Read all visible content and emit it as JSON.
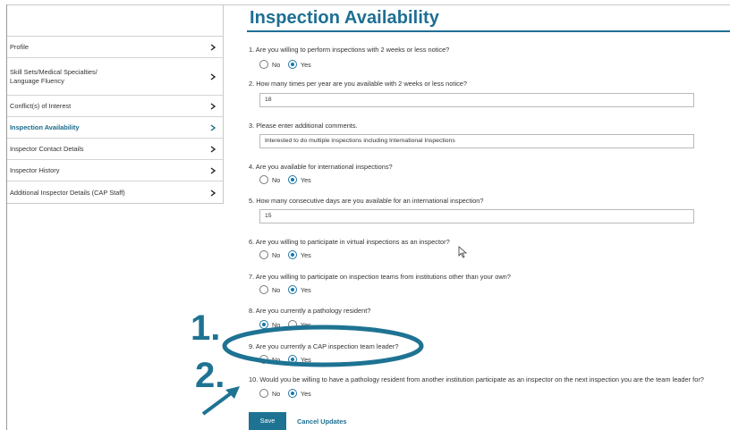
{
  "sidebar": {
    "items": [
      {
        "label": "Profile",
        "active": false
      },
      {
        "label": "Skill Sets/Medical Specialties/\nLanguage Fluency",
        "active": false
      },
      {
        "label": "Conflict(s) of Interest",
        "active": false
      },
      {
        "label": "Inspection Availability",
        "active": true
      },
      {
        "label": "Inspector Contact Details",
        "active": false
      },
      {
        "label": "Inspector History",
        "active": false
      },
      {
        "label": "Additional Inspector Details (CAP Staff)",
        "active": false
      }
    ]
  },
  "main": {
    "title": "Inspection Availability",
    "questions": {
      "q1": {
        "text": "1.  Are you willing to perform inspections with 2 weeks or less notice?",
        "no": "No",
        "yes": "Yes",
        "selected": "Yes"
      },
      "q2": {
        "text": "2.  How many times per year are you available with 2 weeks or less notice?",
        "value": "18"
      },
      "q3": {
        "text": "3.  Please enter additional comments.",
        "value": "Interested to do multiple inspections including International Inspections"
      },
      "q4": {
        "text": "4.  Are you available for international inspections?",
        "no": "No",
        "yes": "Yes",
        "selected": "Yes"
      },
      "q5": {
        "text": "5.  How many consecutive days are you available for an international inspection?",
        "value": "15"
      },
      "q6": {
        "text": "6.  Are you willing to participate in virtual inspections as an inspector?",
        "no": "No",
        "yes": "Yes",
        "selected": "Yes"
      },
      "q7": {
        "text": "7.  Are you willing to participate on inspection teams from institutions other than your own?",
        "no": "No",
        "yes": "Yes",
        "selected": "Yes"
      },
      "q8": {
        "text": "8.  Are you currently a pathology resident?",
        "no": "No",
        "yes": "Yes",
        "selected": "No"
      },
      "q9": {
        "text": "9.  Are you currently a CAP inspection team leader?",
        "no": "No",
        "yes": "Yes",
        "selected": "Yes"
      },
      "q10": {
        "text": "10.  Would you be willing to have a pathology resident from another institution participate as an inspector on the next inspection you are the team leader for?",
        "no": "No",
        "yes": "Yes",
        "selected": "Yes"
      }
    },
    "save_label": "Save",
    "cancel_label": "Cancel Updates"
  },
  "annotations": {
    "label_1": "1.",
    "label_2": "2.",
    "accent_color": "#1e7393"
  }
}
